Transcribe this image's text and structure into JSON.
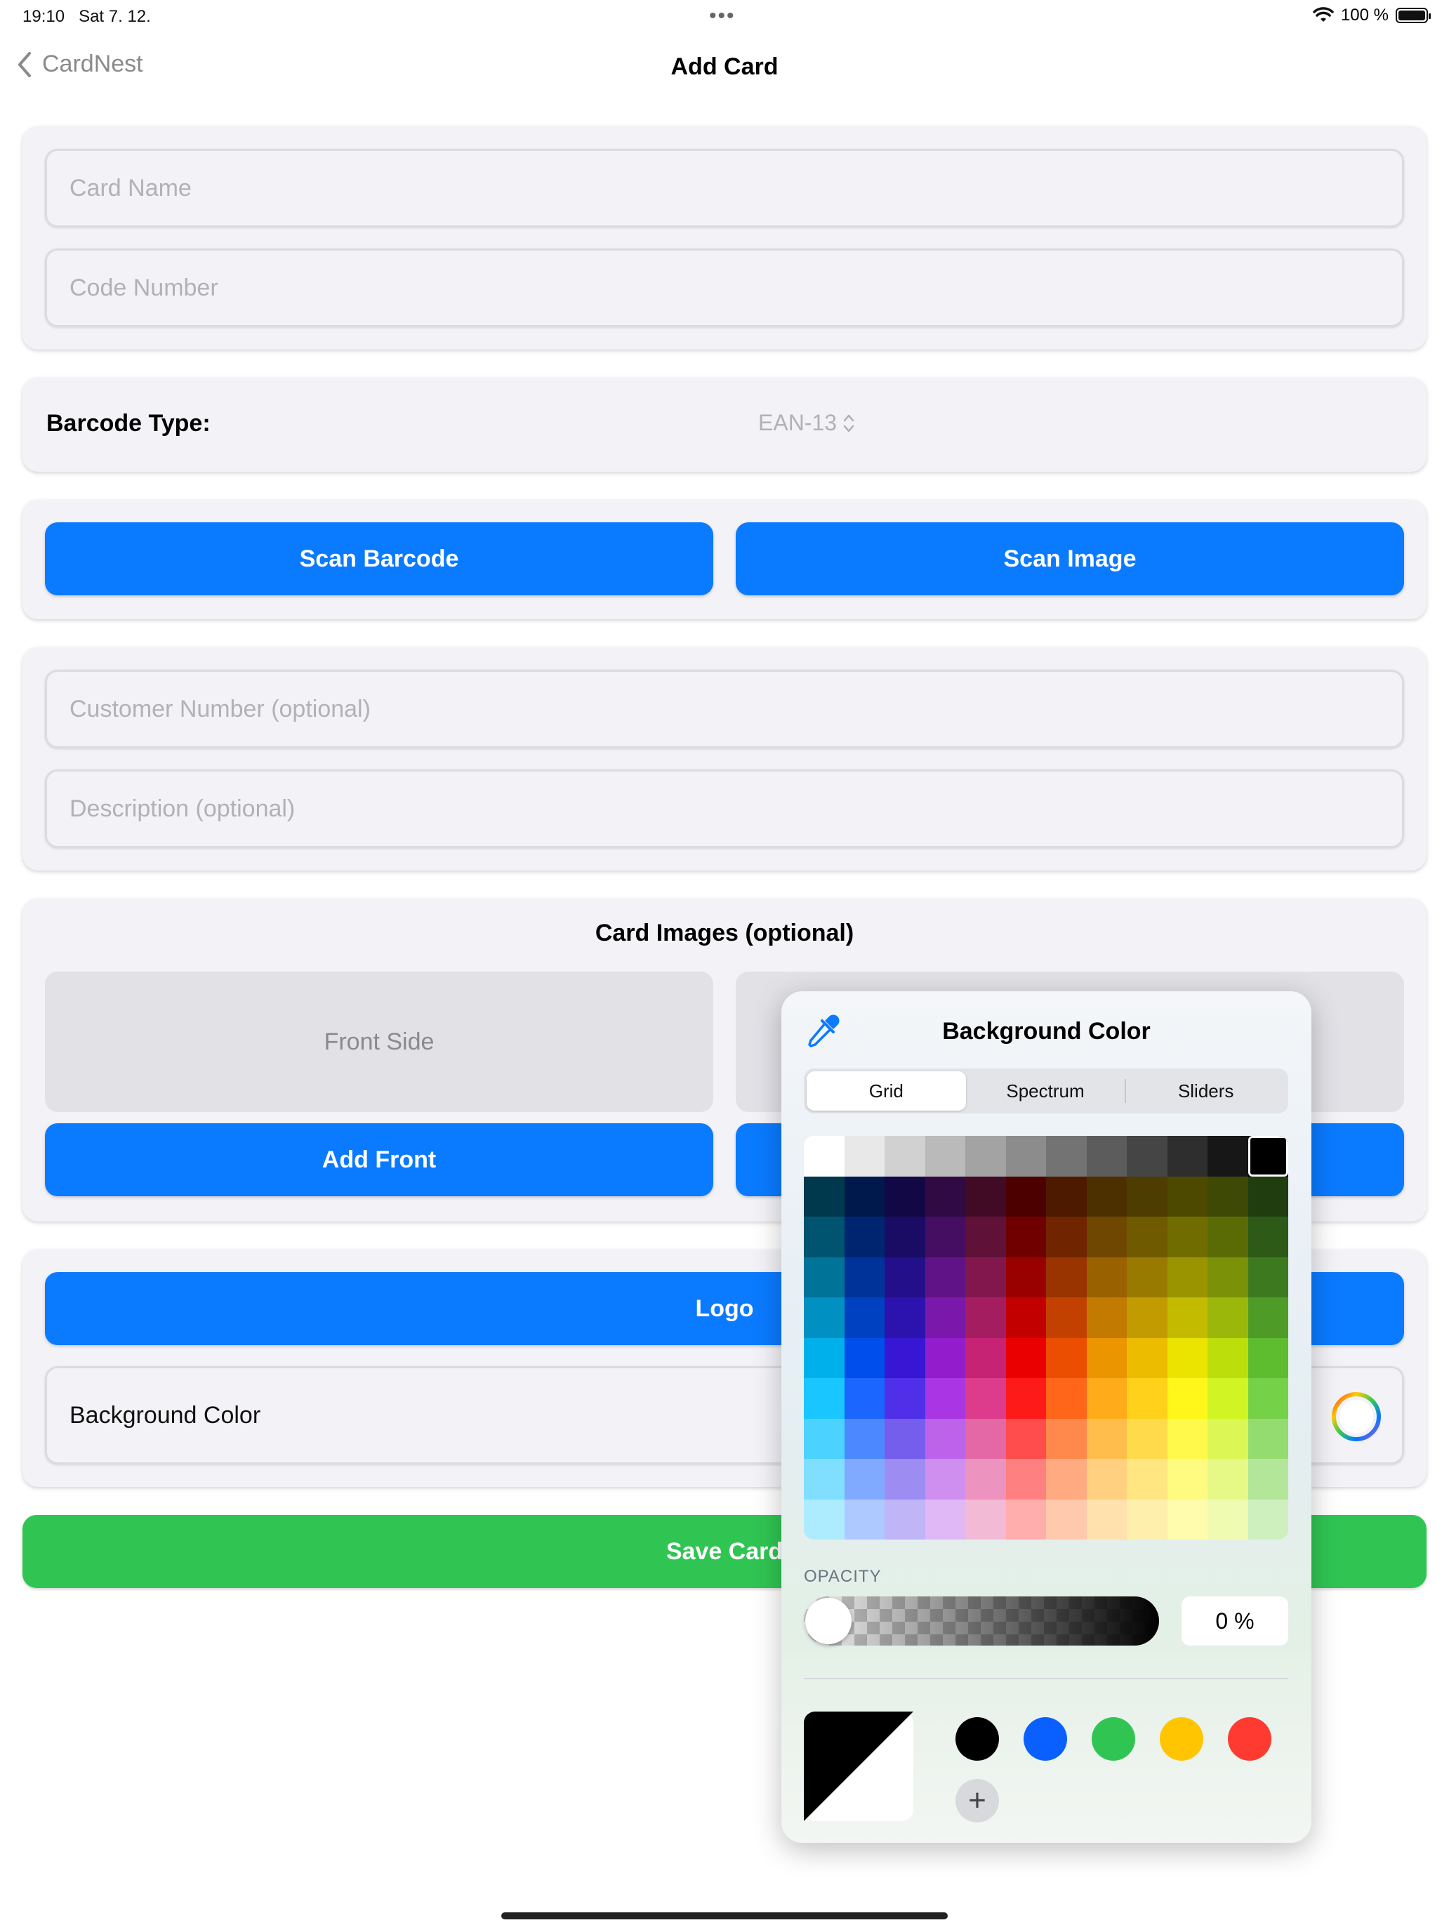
{
  "status_bar": {
    "time": "19:10",
    "date": "Sat 7. 12.",
    "battery": "100 %"
  },
  "nav": {
    "back_label": "CardNest",
    "title": "Add Card"
  },
  "form": {
    "card_name_placeholder": "Card Name",
    "code_number_placeholder": "Code Number",
    "barcode_type_label": "Barcode Type:",
    "barcode_type_value": "EAN-13",
    "scan_barcode_label": "Scan Barcode",
    "scan_image_label": "Scan Image",
    "customer_number_placeholder": "Customer Number (optional)",
    "description_placeholder": "Description (optional)",
    "card_images_title": "Card Images (optional)",
    "front_side_label": "Front Side",
    "add_front_label": "Add Front",
    "logo_label": "Logo",
    "background_color_label": "Background Color",
    "save_card_label": "Save Card"
  },
  "color_picker": {
    "title": "Background Color",
    "tabs": [
      "Grid",
      "Spectrum",
      "Sliders"
    ],
    "active_tab": "Grid",
    "opacity_label": "OPACITY",
    "opacity_value": "0 %",
    "opacity_fraction": 0,
    "selected_color": "#000000",
    "preset_swatches": [
      "#000000",
      "#0a60ff",
      "#30c552",
      "#ffc500",
      "#ff3a30"
    ]
  }
}
